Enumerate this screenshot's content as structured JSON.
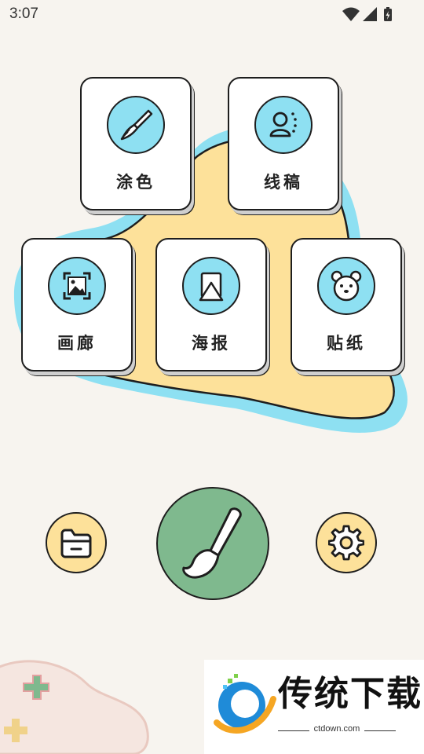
{
  "status_bar": {
    "time": "3:07"
  },
  "menu": {
    "coloring": "涂色",
    "lineart": "线稿",
    "gallery": "画廊",
    "poster": "海报",
    "sticker": "贴纸"
  },
  "colors": {
    "background": "#f7f4ef",
    "blob_yellow": "#fde19a",
    "blob_blue": "#8ee0f2",
    "icon_circle": "#8ee0f2",
    "folder_button": "#fde19a",
    "brush_button": "#7fb98e",
    "settings_button": "#fde19a"
  },
  "icons": {
    "coloring": "paintbrush-icon",
    "lineart": "person-sketch-icon",
    "gallery": "image-icon",
    "poster": "poster-icon",
    "sticker": "bear-icon",
    "folder": "folder-icon",
    "brush": "brush-icon",
    "settings": "gear-icon"
  },
  "ad": {
    "title": "传统下载",
    "subtitle": "ctdown.com"
  }
}
